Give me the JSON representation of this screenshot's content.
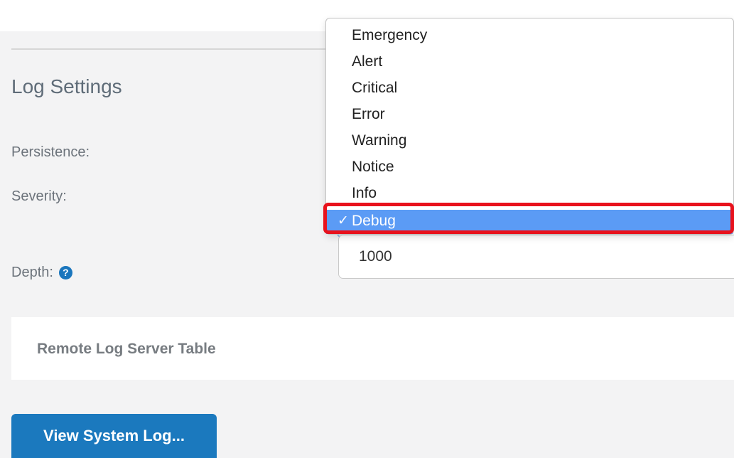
{
  "log_settings": {
    "title": "Log Settings",
    "persistence_label": "Persistence:",
    "severity_label": "Severity:",
    "depth_label": "Depth:",
    "depth_help_glyph": "?",
    "depth_value": "1000"
  },
  "severity_dropdown": {
    "check_glyph": "✓",
    "options": [
      {
        "label": "Emergency",
        "selected": false
      },
      {
        "label": "Alert",
        "selected": false
      },
      {
        "label": "Critical",
        "selected": false
      },
      {
        "label": "Error",
        "selected": false
      },
      {
        "label": "Warning",
        "selected": false
      },
      {
        "label": "Notice",
        "selected": false
      },
      {
        "label": "Info",
        "selected": false
      },
      {
        "label": "Debug",
        "selected": true
      }
    ]
  },
  "remote_log": {
    "panel_title": "Remote Log Server Table"
  },
  "actions": {
    "view_log_label": "View System Log..."
  },
  "colors": {
    "primary": "#1b79be",
    "selected_option": "#5b9bf5",
    "highlight": "#e8121c"
  }
}
